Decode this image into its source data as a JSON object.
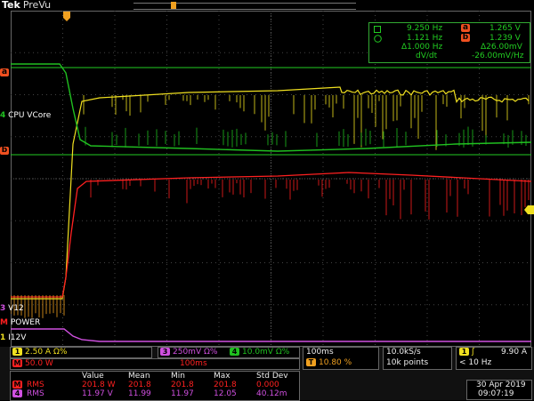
{
  "header": {
    "brand": "Tek",
    "mode": "PreVu",
    "trigger_marker": "T"
  },
  "readout": {
    "row1_left": "9.250 Hz",
    "row1_right_badge": "a",
    "row1_right": "1.265 V",
    "row2_left": "1.121 Hz",
    "row2_right_badge": "b",
    "row2_right": "1.239 V",
    "row3_left": "Δ1.000 Hz",
    "row3_right": "Δ26.00mV",
    "row4_left": "dV/dt",
    "row4_right": "-26.00mV/Hz"
  },
  "channel_labels": {
    "cursor_a": "a",
    "cursor_b": "b",
    "cpu": "CPU VCore",
    "v12": "V12",
    "power": "POWER",
    "i12": "I12V"
  },
  "status": {
    "ch1_num": "1",
    "ch1_scale": "2.50 A",
    "ch1_flags": "Ω%",
    "ch3_num": "3",
    "ch3_scale": "250mV",
    "ch3_flags": "Ω%",
    "ch4_num": "4",
    "ch4_scale": "10.0mV",
    "ch4_flags": "Ω%",
    "math_num": "M",
    "math_scale": "50.0 W",
    "math_time": "100ms",
    "timebase": "100ms",
    "trig_pos_badge": "T",
    "trig_pos": "10.80 %",
    "sample_rate": "10.0kS/s",
    "record": "10k points",
    "trig_src": "1",
    "trig_slope": "ʃ",
    "trig_level": "9.90 A",
    "trig_freq": "< 10 Hz",
    "date": "30 Apr 2019",
    "time": "09:07:19"
  },
  "measurements": {
    "headers": [
      "Value",
      "Mean",
      "Min",
      "Max",
      "Std Dev"
    ],
    "rows": [
      {
        "badge": "M",
        "label": "RMS",
        "values": [
          "201.8 W",
          "201.8",
          "201.8",
          "201.8",
          "0.000"
        ]
      },
      {
        "badge": "4",
        "label": "RMS",
        "values": [
          "11.97 V",
          "11.99",
          "11.97",
          "12.05",
          "40.12m"
        ]
      }
    ]
  },
  "colors": {
    "ch1": "#f0e020",
    "ch2": "#00c8ff",
    "ch3": "#d050e0",
    "ch4": "#20c020",
    "math": "#ff2020",
    "grid": "#555555",
    "trigger": "#f0a020"
  }
}
